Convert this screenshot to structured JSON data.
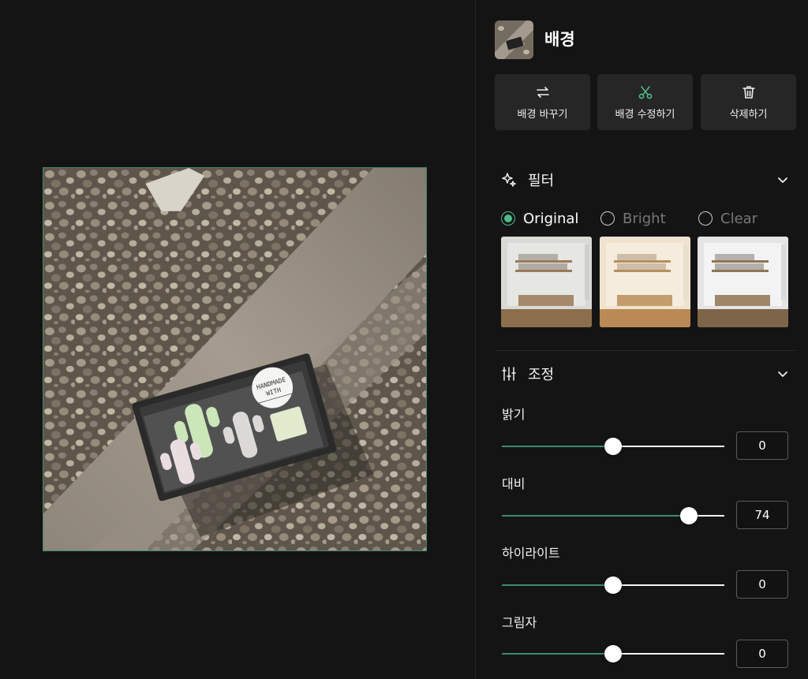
{
  "layer": {
    "title": "배경"
  },
  "actions": [
    {
      "label": "배경 바꾸기",
      "icon": "swap-arrows-icon"
    },
    {
      "label": "배경 수정하기",
      "icon": "scissors-icon"
    },
    {
      "label": "삭제하기",
      "icon": "trash-icon"
    }
  ],
  "filter": {
    "title": "필터",
    "icon": "sparkle-icon",
    "options": [
      {
        "label": "Original",
        "selected": true
      },
      {
        "label": "Bright",
        "selected": false
      },
      {
        "label": "Clear",
        "selected": false
      }
    ]
  },
  "adjust": {
    "title": "조정",
    "icon": "sliders-icon",
    "items": [
      {
        "label": "밝기",
        "value": "0",
        "level": 0.5
      },
      {
        "label": "대비",
        "value": "74",
        "level": 0.84
      },
      {
        "label": "하이라이트",
        "value": "0",
        "level": 0.5
      },
      {
        "label": "그림자",
        "value": "0",
        "level": 0.5
      }
    ]
  },
  "photo": {
    "label_line1": "HANDMADE",
    "label_line2": "WITH"
  },
  "colors": {
    "accent": "#4fb98a",
    "panel_bg": "#141414",
    "button_bg": "#262626"
  }
}
